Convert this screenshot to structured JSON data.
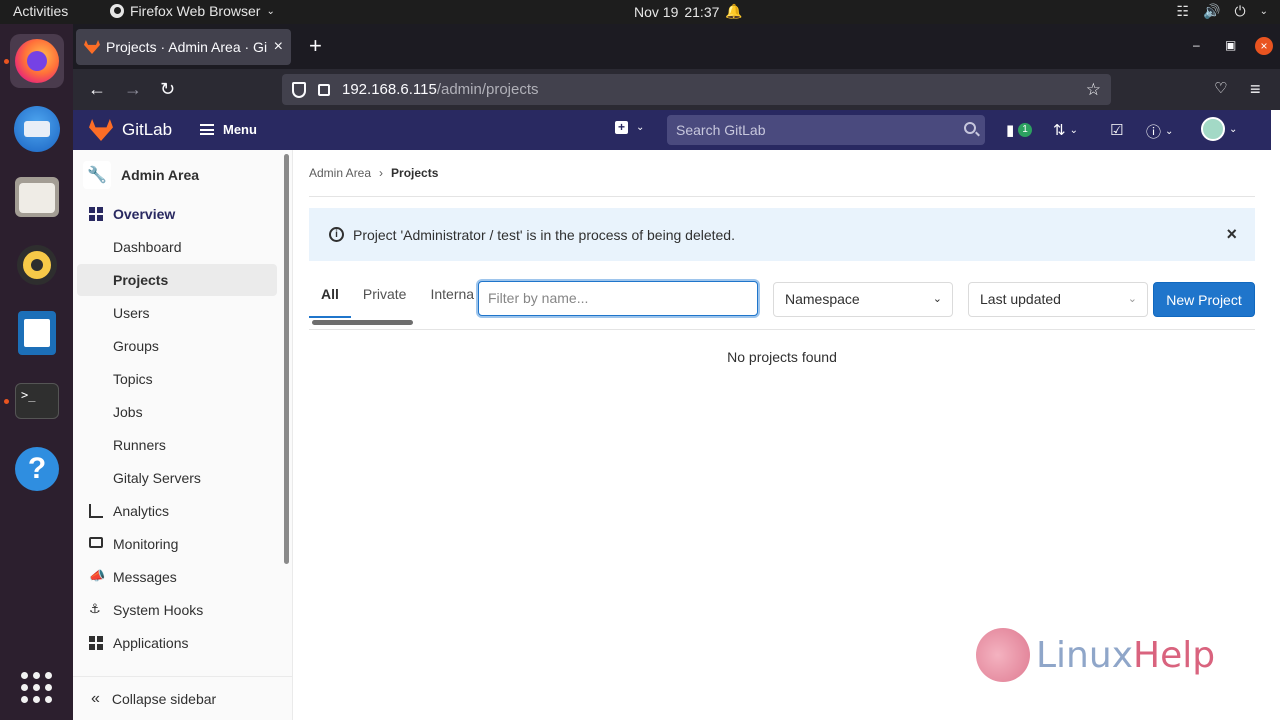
{
  "os": {
    "activities": "Activities",
    "app_name": "Firefox Web Browser",
    "date": "Nov 19",
    "time": "21:37"
  },
  "browser": {
    "tab_title": "Projects · Admin Area · Gi",
    "url_host": "192.168.6.115",
    "url_path": "/admin/projects"
  },
  "gitlab": {
    "brand": "GitLab",
    "menu_label": "Menu",
    "search_placeholder": "Search GitLab",
    "issues_badge": "1"
  },
  "sidebar": {
    "title": "Admin Area",
    "items": [
      {
        "label": "Overview"
      },
      {
        "label": "Dashboard"
      },
      {
        "label": "Projects"
      },
      {
        "label": "Users"
      },
      {
        "label": "Groups"
      },
      {
        "label": "Topics"
      },
      {
        "label": "Jobs"
      },
      {
        "label": "Runners"
      },
      {
        "label": "Gitaly Servers"
      },
      {
        "label": "Analytics"
      },
      {
        "label": "Monitoring"
      },
      {
        "label": "Messages"
      },
      {
        "label": "System Hooks"
      },
      {
        "label": "Applications"
      }
    ],
    "collapse_label": "Collapse sidebar"
  },
  "main": {
    "breadcrumb": [
      "Admin Area",
      "Projects"
    ],
    "alert_text": "Project 'Administrator / test' is in the process of being deleted.",
    "tabs": [
      "All",
      "Private",
      "Interna"
    ],
    "filter_placeholder": "Filter by name...",
    "namespace_label": "Namespace",
    "sort_label": "Last updated",
    "new_project_label": "New Project",
    "empty_text": "No projects found"
  },
  "watermark": {
    "text_a": "Linux",
    "text_b": "Help"
  },
  "colors": {
    "gitlab_header": "#292961",
    "primary_button": "#1f75cb",
    "alert_bg": "#e9f3fc",
    "ubuntu_accent": "#e95420"
  }
}
